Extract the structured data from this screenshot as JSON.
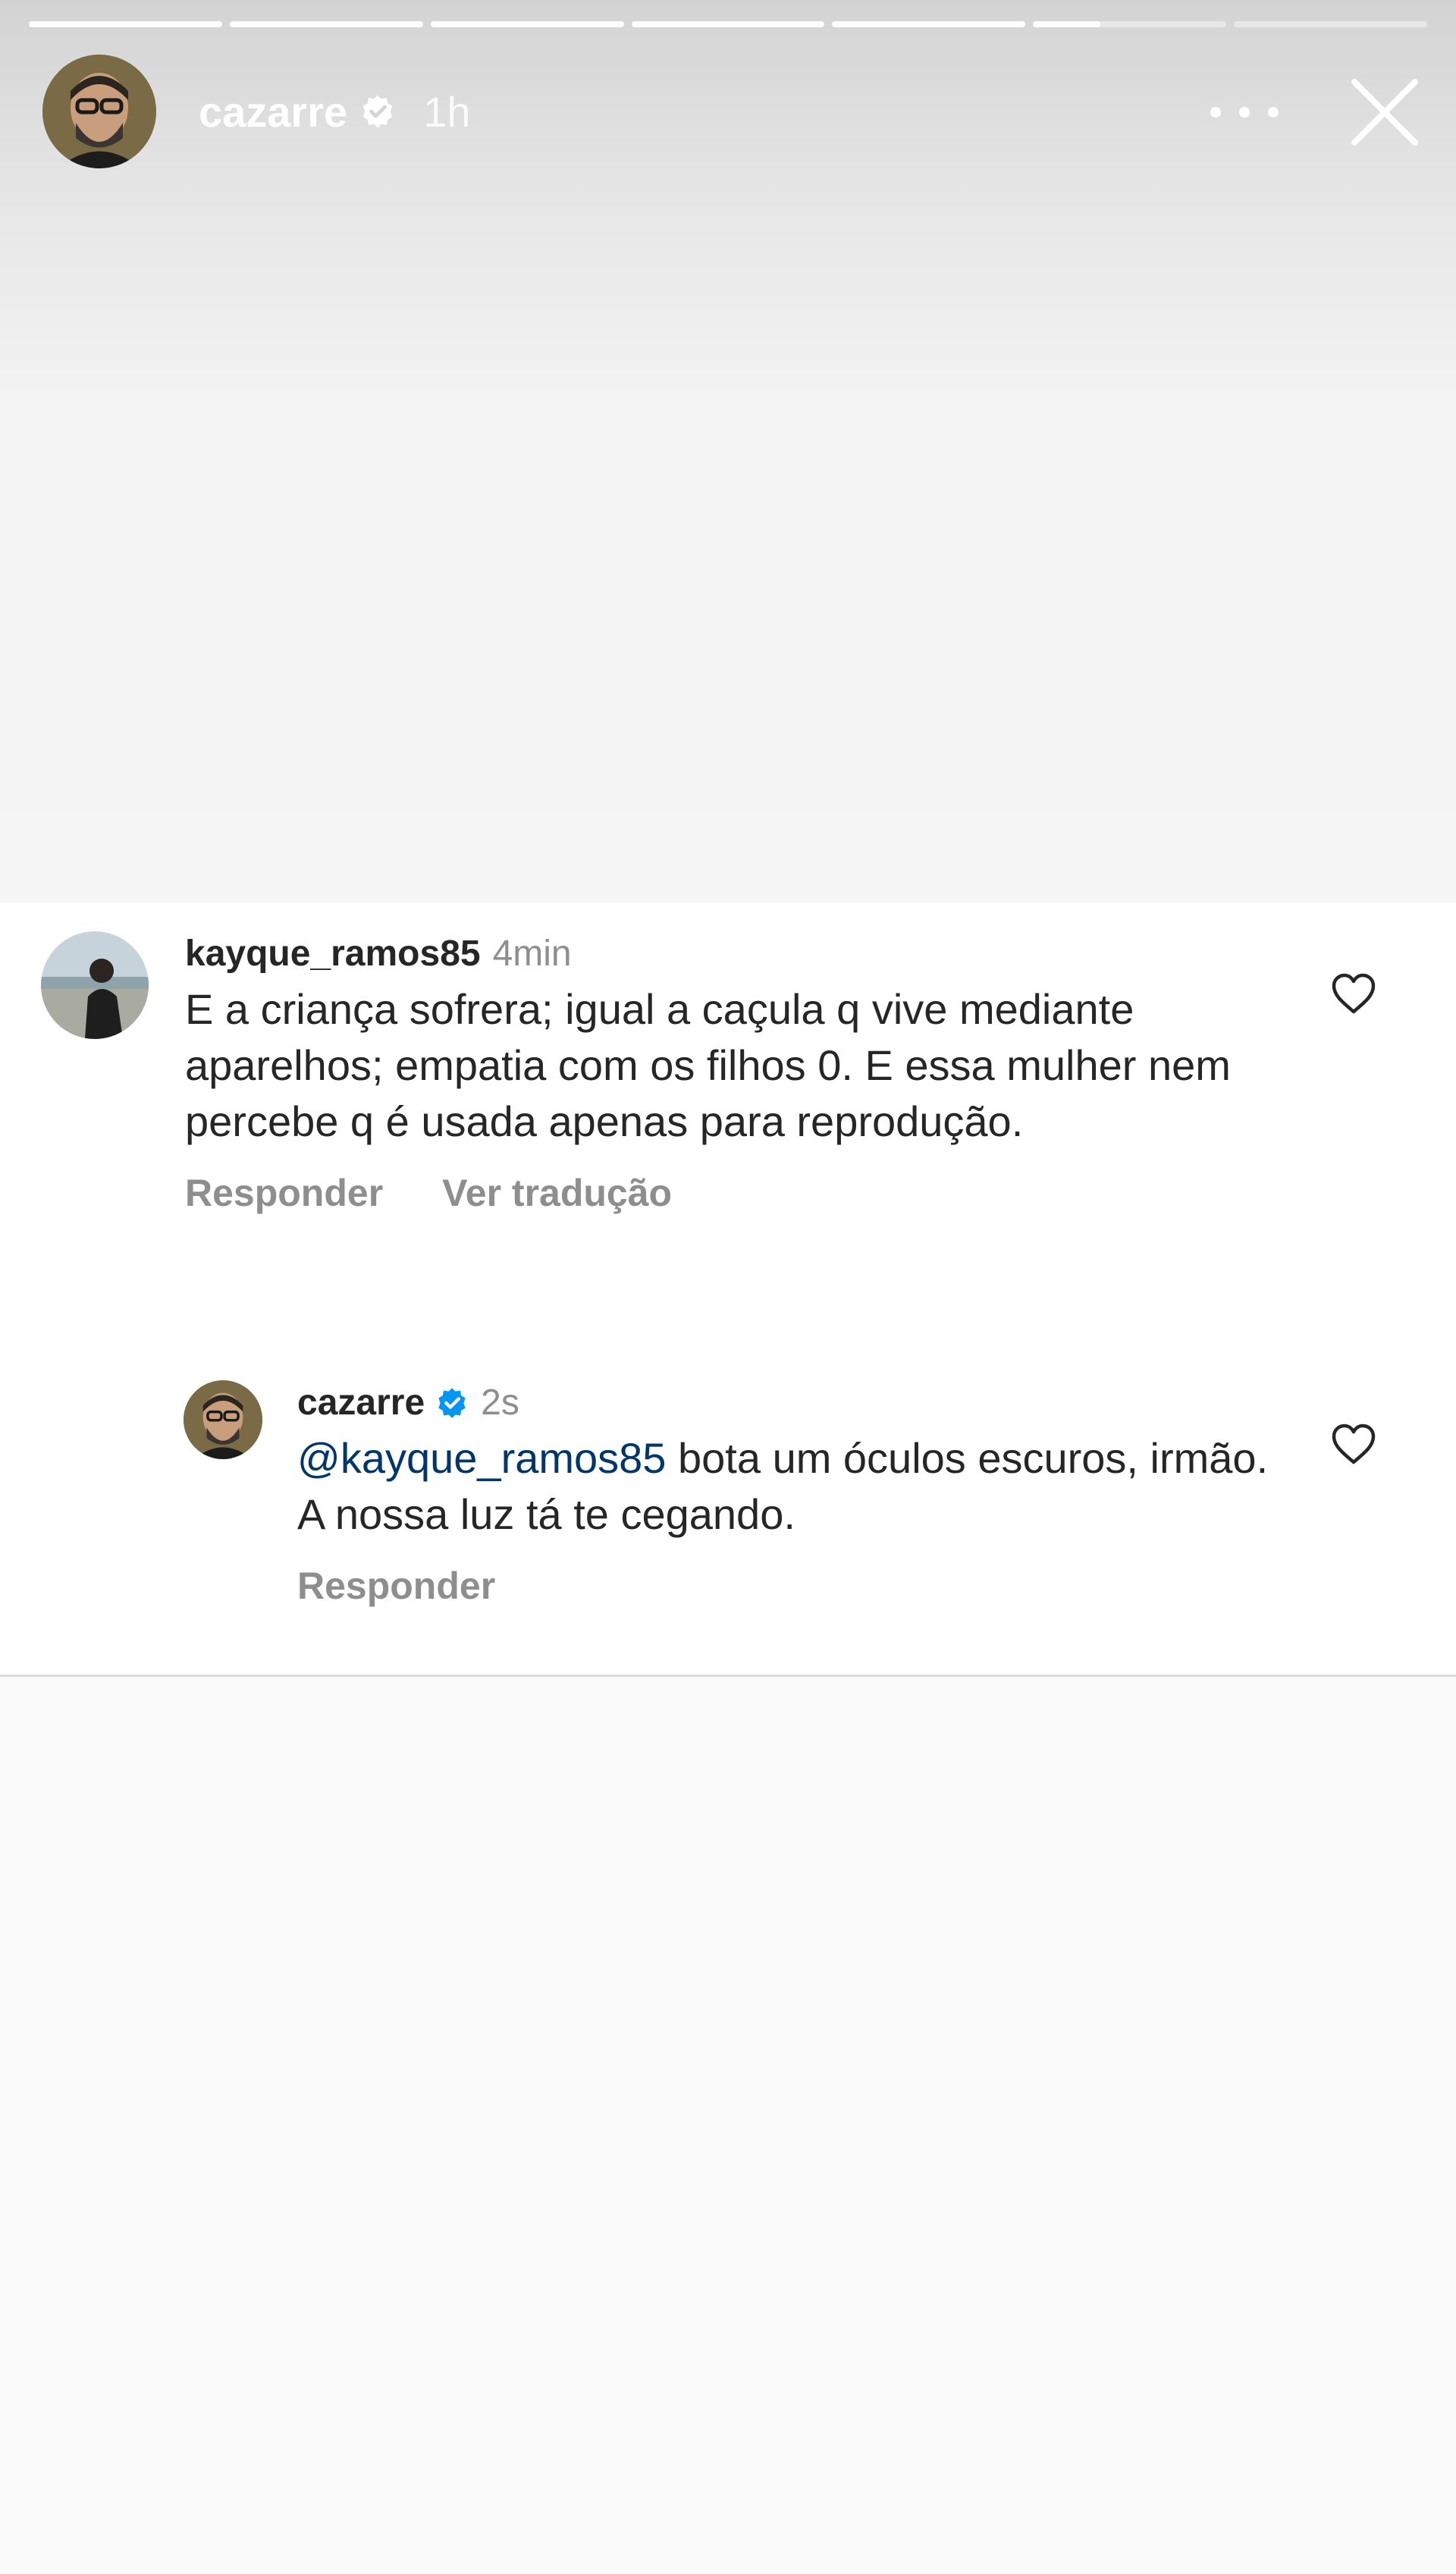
{
  "story": {
    "progress_segments": [
      1,
      1,
      1,
      1,
      1,
      0.35,
      0
    ],
    "username": "cazarre",
    "verified": true,
    "time": "1h"
  },
  "comment": {
    "username": "kayque_ramos85",
    "time": "4min",
    "text": "E a criança sofrera; igual a caçula q vive mediante aparelhos; empatia com os filhos 0. E essa mulher nem percebe q é usada apenas para reprodução.",
    "reply_label": "Responder",
    "translate_label": "Ver tradução"
  },
  "reply": {
    "username": "cazarre",
    "verified": true,
    "time": "2s",
    "mention": "@kayque_ramos85",
    "text": " bota um óculos escuros, irmão. A nossa luz tá te cegando.",
    "reply_label": "Responder"
  },
  "colors": {
    "text": "#262626",
    "muted": "#8e8e8e",
    "mention": "#00376b",
    "verified": "#0095f6"
  }
}
